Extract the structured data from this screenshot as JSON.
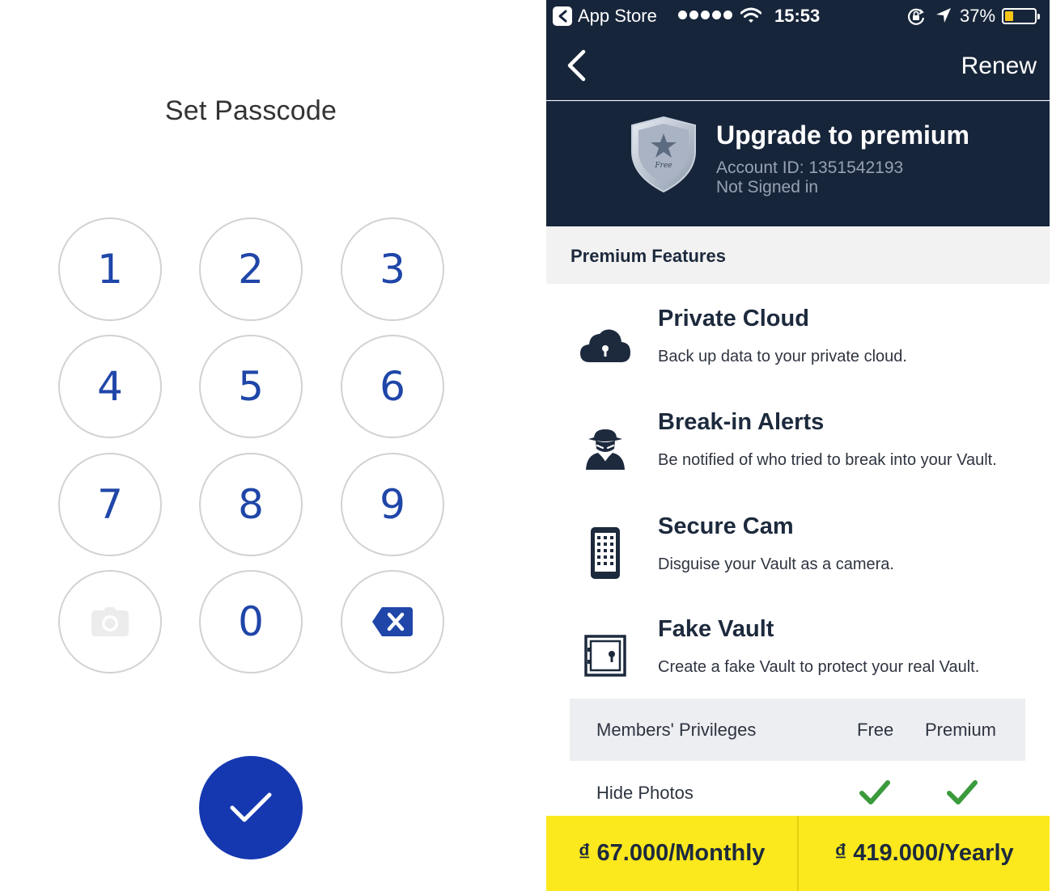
{
  "passcode": {
    "title": "Set Passcode",
    "keys": [
      "1",
      "2",
      "3",
      "4",
      "5",
      "6",
      "7",
      "8",
      "9",
      "0"
    ],
    "camera_icon": "camera-icon",
    "delete_icon": "backspace-icon",
    "confirm_icon": "checkmark-icon",
    "accent_color": "#1538b0"
  },
  "status_bar": {
    "back_app": "App Store",
    "time": "15:53",
    "battery": "37%",
    "battery_level": 0.37
  },
  "nav": {
    "back_icon": "chevron-left-icon",
    "renew_label": "Renew"
  },
  "hero": {
    "title": "Upgrade to premium",
    "account_id": "Account ID: 1351542193",
    "sign_status": "Not Signed in",
    "badge_text": "Free"
  },
  "section": {
    "title": "Premium Features"
  },
  "features": [
    {
      "icon": "cloud-lock-icon",
      "title": "Private Cloud",
      "desc": "Back up data to your private cloud."
    },
    {
      "icon": "spy-icon",
      "title": "Break-in Alerts",
      "desc": "Be notified of who tried to break into your Vault."
    },
    {
      "icon": "keypad-phone-icon",
      "title": "Secure Cam",
      "desc": "Disguise your Vault as a camera."
    },
    {
      "icon": "safe-icon",
      "title": "Fake Vault",
      "desc": "Create a fake Vault to protect your real Vault."
    }
  ],
  "privileges": {
    "header": "Members' Privileges",
    "col_free": "Free",
    "col_premium": "Premium",
    "rows": [
      {
        "label": "Hide Photos",
        "free": true,
        "premium": true
      }
    ]
  },
  "purchase": {
    "monthly": "₫ 67.000/Monthly",
    "yearly": "₫ 419.000/Yearly",
    "color": "#fbe81d"
  },
  "colors": {
    "navy": "#17253a",
    "check_green": "#3a9a3c"
  }
}
